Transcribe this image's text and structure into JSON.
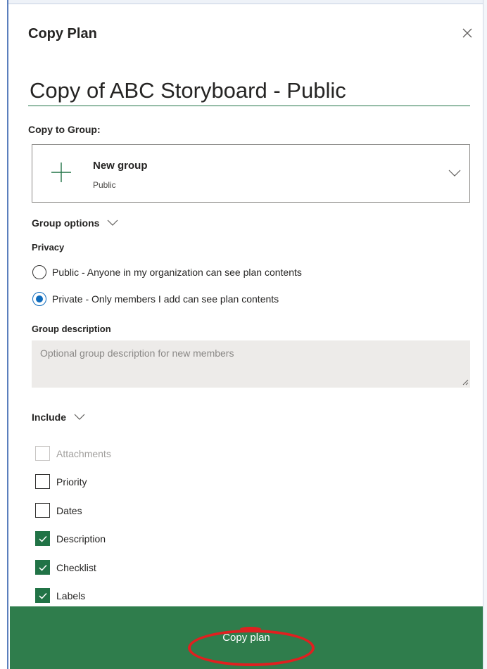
{
  "dialog": {
    "title": "Copy Plan",
    "close_icon": "close-icon"
  },
  "plan_name": {
    "value": "Copy of ABC Storyboard - Public"
  },
  "copy_to_group": {
    "label": "Copy to Group:",
    "selected_name": "New group",
    "selected_privacy": "Public",
    "icons": [
      "plus-icon",
      "chevron-down-icon"
    ]
  },
  "group_options": {
    "label": "Group options",
    "privacy_label": "Privacy",
    "privacy_options": [
      {
        "label": "Public - Anyone in my organization can see plan contents",
        "checked": false
      },
      {
        "label": "Private - Only members I add can see plan contents",
        "checked": true
      }
    ],
    "description_label": "Group description",
    "description_placeholder": "Optional group description for new members"
  },
  "include": {
    "label": "Include",
    "items": [
      {
        "label": "Attachments",
        "checked": false,
        "disabled": true
      },
      {
        "label": "Priority",
        "checked": false,
        "disabled": false
      },
      {
        "label": "Dates",
        "checked": false,
        "disabled": false
      },
      {
        "label": "Description",
        "checked": true,
        "disabled": false
      },
      {
        "label": "Checklist",
        "checked": true,
        "disabled": false
      },
      {
        "label": "Labels",
        "checked": true,
        "disabled": false
      }
    ]
  },
  "footer": {
    "copy_label": "Copy plan"
  },
  "colors": {
    "accent_green": "#217346",
    "footer_green": "#2f7d4c",
    "radio_blue": "#0f6cbd",
    "annotation_red": "#e02020"
  }
}
